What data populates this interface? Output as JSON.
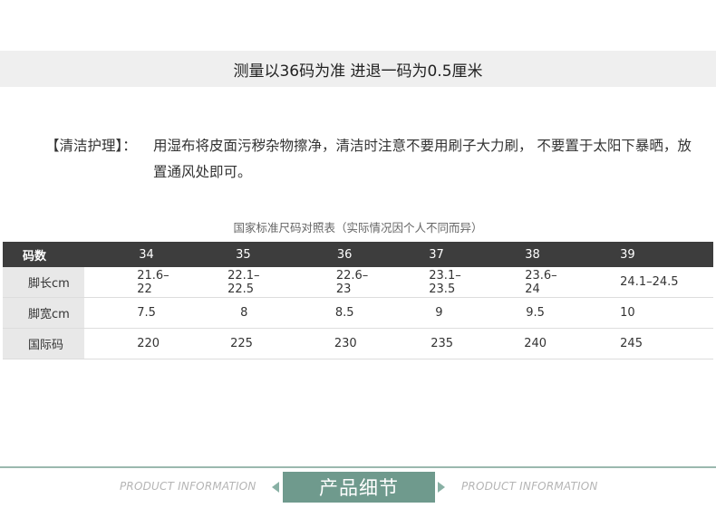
{
  "banner": {
    "text": "测量以36码为准  进退一码为0.5厘米"
  },
  "care": {
    "label": "【清洁护理】：",
    "text": "用湿布将皮面污秽杂物擦净，清洁时注意不要用刷子大力刷，  不要置于太阳下暴晒，放置通风处即可。"
  },
  "size_table": {
    "caption": "国家标准尺码对照表（实际情况因个人不同而异）",
    "header": {
      "label": "码数",
      "sizes": [
        "34",
        "35",
        "36",
        "37",
        "38",
        "39"
      ]
    },
    "rows": [
      {
        "label": "脚长cm",
        "values": [
          "21.6–22",
          "22.1–22.5",
          "22.6–23",
          "23.1–23.5",
          "23.6–24",
          "24.1–24.5"
        ]
      },
      {
        "label": "脚宽cm",
        "values": [
          "7.5",
          "8",
          "8.5",
          "9",
          "9.5",
          "10"
        ]
      },
      {
        "label": "国际码",
        "values": [
          "220",
          "225",
          "230",
          "235",
          "240",
          "245"
        ]
      }
    ]
  },
  "footer": {
    "left_text": "PRODUCT INFORMATION",
    "title": "产品细节",
    "right_text": "PRODUCT INFORMATION"
  },
  "colors": {
    "accent": "#6f9a8d",
    "header_bg": "#3d3d3d",
    "banner_bg": "#efefef"
  }
}
